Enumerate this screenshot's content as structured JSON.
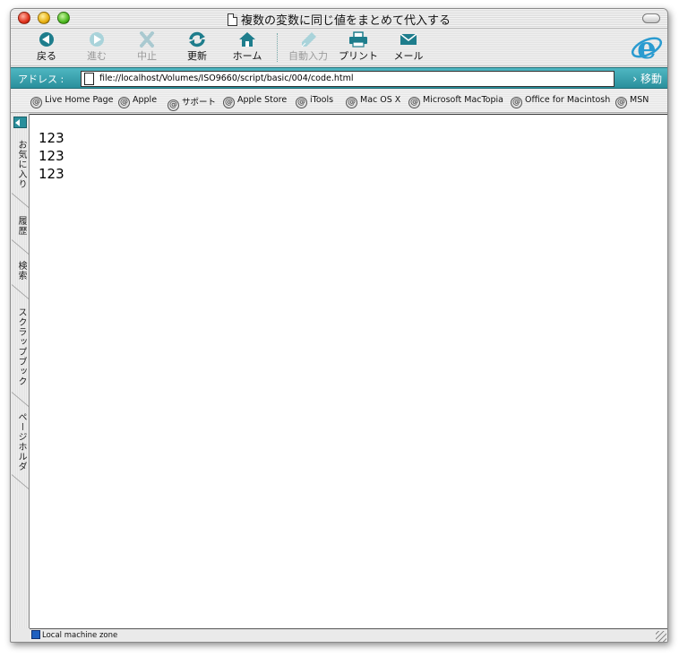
{
  "window": {
    "title": "複数の変数に同じ値をまとめて代入する"
  },
  "toolbar": {
    "back_label": "戻る",
    "forward_label": "進む",
    "stop_label": "中止",
    "refresh_label": "更新",
    "home_label": "ホーム",
    "autofill_label": "自動入力",
    "print_label": "プリント",
    "mail_label": "メール"
  },
  "address": {
    "label": "アドレス :",
    "url": "file://localhost/Volumes/ISO9660/script/basic/004/code.html",
    "go_label": "移動"
  },
  "favorites": [
    "Live Home Page",
    "Apple",
    "サポート",
    "Apple Store",
    "iTools",
    "Mac OS X",
    "Microsoft MacTopia",
    "Office for Macintosh",
    "MSN"
  ],
  "sidebar": {
    "tabs": [
      "お気に入り",
      "履歴",
      "検索",
      "スクラップブック",
      "ページホルダ"
    ]
  },
  "content": {
    "lines": [
      "123",
      "123",
      "123"
    ]
  },
  "status": {
    "zone": "Local machine zone"
  },
  "colors": {
    "accent": "#2a8f9c",
    "toolbar_icon": "#1e7d8c"
  }
}
